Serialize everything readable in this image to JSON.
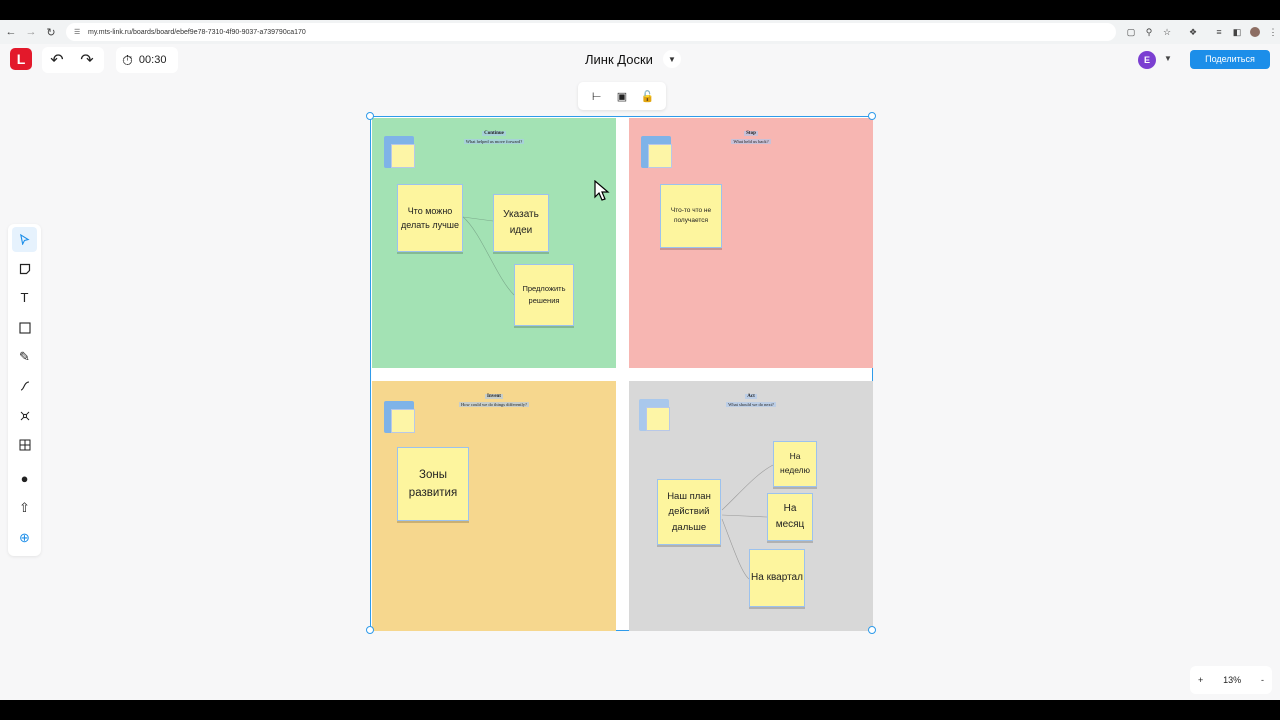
{
  "browser": {
    "url": "my.mts-link.ru/boards/board/ebef9e78-7310-4f90-9037-a739790ca170"
  },
  "app": {
    "title": "Линк Доски",
    "timer": "00:30",
    "user_initial": "E",
    "share_label": "Поделиться",
    "zoom_level": "13%",
    "zoom_in": "+",
    "zoom_out": "-"
  },
  "board": {
    "quadrants": [
      {
        "title": "Continue",
        "subtitle": "What helped us move forward?",
        "color": "#a3e2b4",
        "notes": [
          "Что можно делать лучше",
          "Указать идеи",
          "Предложить решения"
        ]
      },
      {
        "title": "Stop",
        "subtitle": "What held us back?",
        "color": "#f7b6b2",
        "notes": [
          "Что-то что не получается"
        ]
      },
      {
        "title": "Invent",
        "subtitle": "How could we do things differently?",
        "color": "#f6d78e",
        "notes": [
          "Зоны развития"
        ]
      },
      {
        "title": "Act",
        "subtitle": "What should we do next?",
        "color": "#d8d8d8",
        "notes": [
          "Наш план действий дальше",
          "На неделю",
          "На месяц",
          "На квартал"
        ]
      }
    ]
  },
  "colors": {
    "accent": "#1c8ee9",
    "brand": "#e3192b",
    "selection": "#2f9bea",
    "sticky": "#fdf59e"
  }
}
